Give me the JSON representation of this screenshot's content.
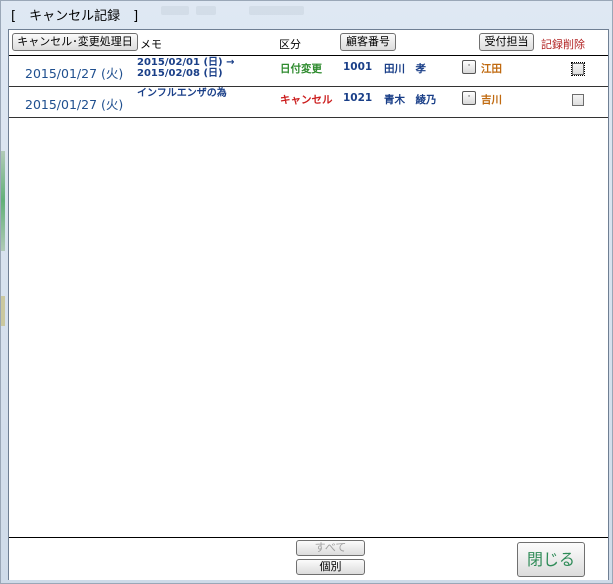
{
  "window": {
    "title": "[　キャンセル記録　]"
  },
  "header": {
    "date_button": "キャンセル･変更処理日",
    "memo_label": "メモ",
    "kubun_label": "区分",
    "customer_button": "顧客番号",
    "staff_button": "受付担当",
    "delete_label": "記録削除"
  },
  "rows": [
    {
      "date": "2015/01/27 (火)",
      "memo_line1": "2015/02/01 (日) →",
      "memo_line2": "2015/02/08 (日)",
      "kubun": "日付変更",
      "kubun_color": "#2e8b2e",
      "customer_no": "1001",
      "customer_name": "田川　孝",
      "staff": "江田",
      "delete_checked": false
    },
    {
      "date": "2015/01/27 (火)",
      "memo_line1": "インフルエンザの為",
      "memo_line2": "",
      "kubun": "キャンセル",
      "kubun_color": "#cc1f1f",
      "customer_no": "1021",
      "customer_name": "青木　綾乃",
      "staff": "吉川",
      "delete_checked": false
    }
  ],
  "footer": {
    "all_button": "すべて",
    "individual_button": "個別",
    "close_button": "閉じる"
  }
}
